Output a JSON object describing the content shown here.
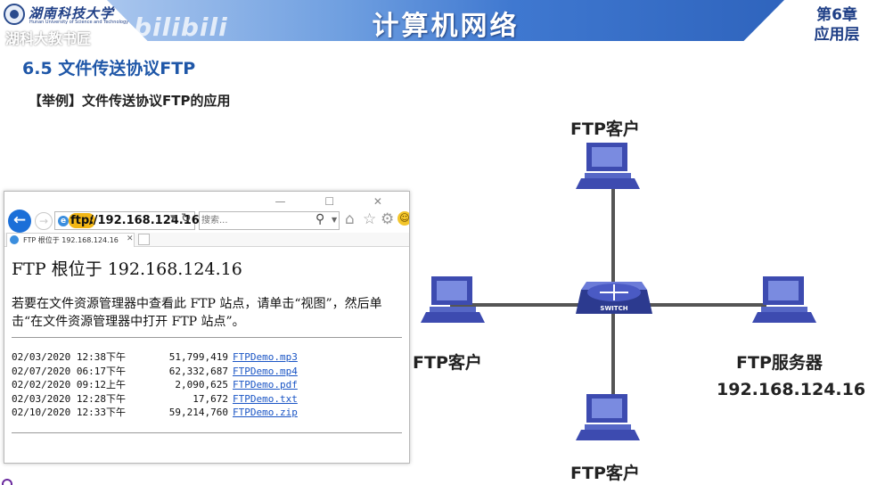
{
  "header": {
    "university": "湖南科技大学",
    "university_en": "Hunan University of Science and Technology",
    "watermark": "湖科大教书匠",
    "bilibili": "bilibili",
    "title": "计算机网络",
    "chapter_line1": "第6章",
    "chapter_line2": "应用层"
  },
  "section_title": "6.5 文件传送协议FTP",
  "example_title": "【举例】文件传送协议FTP的应用",
  "browser": {
    "window_controls": "— ☐ ✕",
    "address_scheme": "ftp:",
    "address_host": "//192.168.124.16",
    "search_placeholder": "搜索...",
    "tab_label": "FTP 根位于 192.168.124.16",
    "page_heading": "FTP 根位于 192.168.124.16",
    "instruction": "若要在文件资源管理器中查看此 FTP 站点，请单击“视图”，然后单击“在文件资源管理器中打开 FTP 站点”。",
    "files": [
      {
        "date": "02/03/2020 12:38下午",
        "size": "51,799,419",
        "name": "FTPDemo.mp3"
      },
      {
        "date": "02/07/2020 06:17下午",
        "size": "62,332,687",
        "name": "FTPDemo.mp4"
      },
      {
        "date": "02/02/2020 09:12上午",
        "size": "2,090,625",
        "name": "FTPDemo.pdf"
      },
      {
        "date": "02/03/2020 12:28下午",
        "size": "17,672",
        "name": "FTPDemo.txt"
      },
      {
        "date": "02/10/2020 12:33下午",
        "size": "59,214,760",
        "name": "FTPDemo.zip"
      }
    ]
  },
  "diagram": {
    "client_top": "FTP客户",
    "client_left": "FTP客户",
    "client_bottom": "FTP客户",
    "server_label": "FTP服务器",
    "server_ip": "192.168.124.16",
    "switch_label": "SWITCH"
  },
  "colors": {
    "accent_blue": "#1f57a8",
    "link_blue": "#1a55c5",
    "switch_blue": "#3d4bb0",
    "device_blue": "#5667c6",
    "cable_gray": "#555555"
  }
}
